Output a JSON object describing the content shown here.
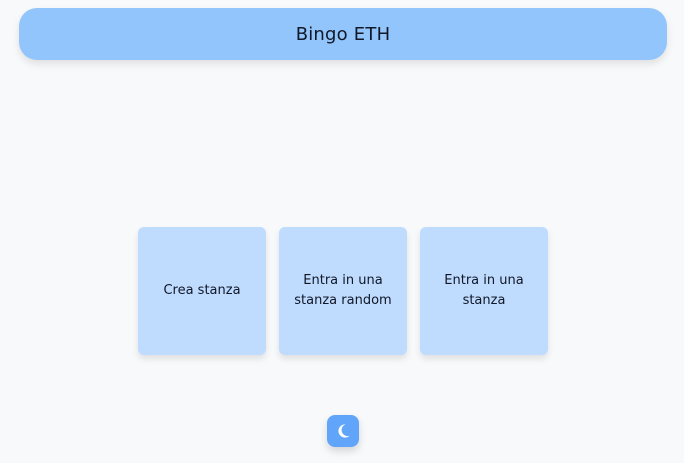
{
  "header": {
    "title": "Bingo ETH"
  },
  "actions": [
    {
      "label": "Crea stanza"
    },
    {
      "label": "Entra in una stanza random"
    },
    {
      "label": "Entra in una stanza"
    }
  ],
  "theme_toggle": {
    "icon": "moon-icon"
  },
  "colors": {
    "background": "#f8f9fb",
    "header": "#93c5fd",
    "card": "#bfdbfe",
    "toggle": "#60a5fa"
  }
}
